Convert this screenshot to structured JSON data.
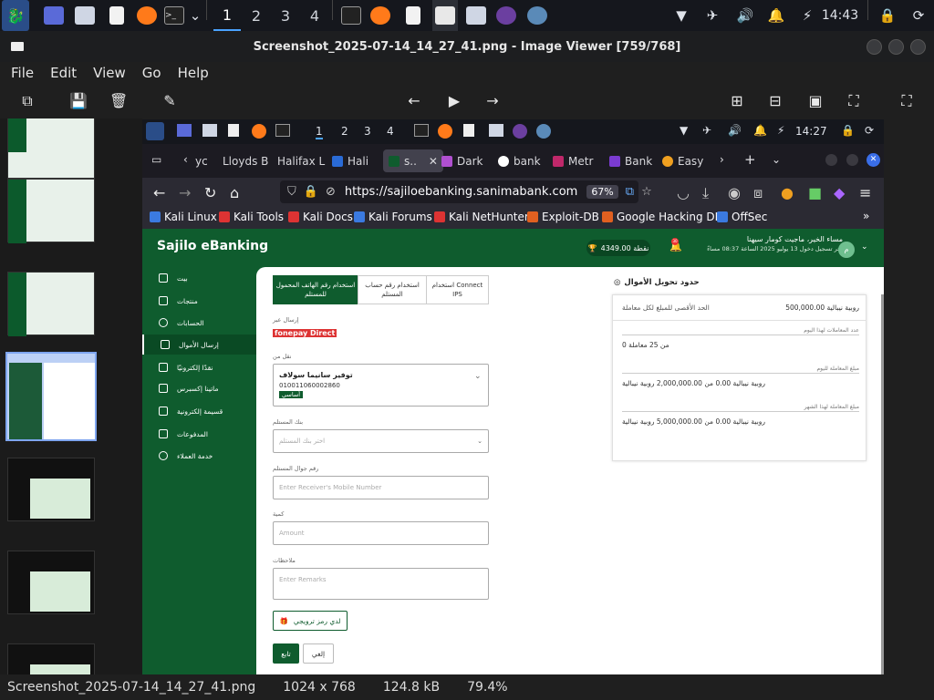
{
  "panel": {
    "workspaces": [
      "1",
      "2",
      "3",
      "4"
    ],
    "clock": "14:43"
  },
  "window": {
    "title": "Screenshot_2025-07-14_14_27_41.png - Image Viewer [759/768]"
  },
  "menu": [
    "File",
    "Edit",
    "View",
    "Go",
    "Help"
  ],
  "status": {
    "filename": "Screenshot_2025-07-14_14_27_41.png",
    "dimensions": "1024 x 768",
    "size": "124.8 kB",
    "zoom": "79.4%"
  },
  "inner": {
    "panel": {
      "workspaces": [
        "1",
        "2",
        "3",
        "4"
      ],
      "clock": "14:27"
    },
    "tabs": [
      {
        "label": "yc"
      },
      {
        "label": "Lloyds B"
      },
      {
        "label": "Halifax L"
      },
      {
        "label": "Hali"
      },
      {
        "label": "s.."
      },
      {
        "label": "Dark"
      },
      {
        "label": "bank"
      },
      {
        "label": "Metr"
      },
      {
        "label": "Bank"
      },
      {
        "label": "Easy"
      }
    ],
    "url": "https://sajiloebanking.sanimabank.com",
    "zoom": "67%",
    "bookmarks": [
      "Kali Linux",
      "Kali Tools",
      "Kali Docs",
      "Kali Forums",
      "Kali NetHunter",
      "Exploit-DB",
      "Google Hacking DB",
      "OffSec"
    ],
    "app": {
      "logo": "Sajilo eBanking",
      "points": "4349.00 نقطة",
      "badge": "30",
      "greeting": "مساء الخير، ماجيت كومار سيهنا",
      "last_login": "آخر تسجيل دخول 13 يوليو 2025 الساعة 08:37 مساءً",
      "avatar": "م",
      "nav": [
        "بيت",
        "منتجات",
        "الحسابات",
        "إرسال الأموال",
        "نقدًا إلكترونيًا",
        "ماتينا إكسبرس",
        "قسيمة إلكترونية",
        "المدفوعات",
        "خدمة العملاء"
      ],
      "segments": [
        {
          "label": "استخدام رقم الهاتف المحمول للمستلم"
        },
        {
          "label": "استخدام رقم حساب المستلم"
        },
        {
          "label": "استخدام Connect IPS"
        }
      ],
      "send_via_label": "إرسال عبر",
      "fonepay": "fonepay Direct",
      "from_label": "نقل من",
      "from_account_name": "توفير سانيما سولاف",
      "from_account_no": "010011060002860",
      "from_account_tag": "أساسي",
      "bank_label": "بنك المستلم",
      "bank_placeholder": "اختر بنك المستلم",
      "mobile_label": "رقم جوال المستلم",
      "mobile_placeholder": "Enter Receiver's Mobile Number",
      "amount_label": "كمية",
      "amount_placeholder": "Amount",
      "remarks_label": "ملاحظات",
      "remarks_placeholder": "Enter Remarks",
      "promo_button": "لدي رمز ترويجي",
      "continue_button": "تابع",
      "cancel_button": "إلغي",
      "limits": {
        "title": "حدود تحويل الأموال",
        "max_label": "الحد الأقصى للمبلغ لكل معاملة",
        "max_value": "روبية نيبالية 500,000.00",
        "daily_count_label": "عدد المعاملات لهذا اليوم",
        "daily_count_value": "0 من 25 معاملة",
        "daily_amount_label": "مبلغ المعاملة لليوم",
        "daily_amount_value": "روبية نيبالية 0.00 من 2,000,000.00 روبية نيبالية",
        "monthly_label": "مبلغ المعاملة لهذا الشهر",
        "monthly_value": "روبية نيبالية 0.00 من 5,000,000.00 روبية نيبالية"
      }
    }
  },
  "colors": {
    "brand_green": "#0f5c2e",
    "selection": "#7ea5ef"
  }
}
